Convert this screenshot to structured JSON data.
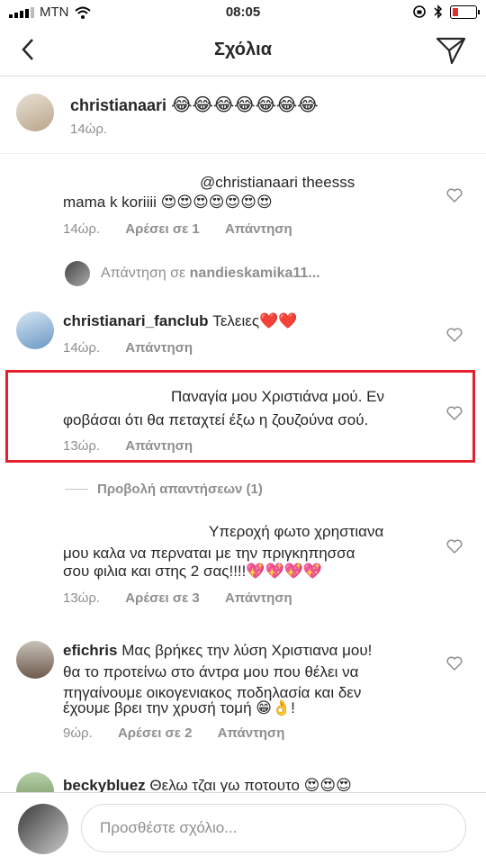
{
  "status_bar": {
    "carrier": "MTN",
    "time": "08:05"
  },
  "header": {
    "title": "Σχόλια"
  },
  "caption": {
    "username": "christianaari",
    "emojis": "😂😂😂😂😂😂😂",
    "time": "14ώρ."
  },
  "comments": [
    {
      "line1": "@christianaari theesss",
      "line2": "mama k koriiii 😍😍😍😍😍😍😍",
      "time": "14ώρ.",
      "likes": "Αρέσει σε 1",
      "reply": "Απάντηση"
    },
    {
      "reply_banner_prefix": "Απάντηση σε",
      "reply_banner_user": "nandieskamika11..."
    },
    {
      "username": "christianari_fanclub",
      "text": "Τελειες❤️❤️",
      "time": "14ώρ.",
      "reply": "Απάντηση"
    },
    {
      "line1": "Παναγία μου Χριστιάνα μού.  Εν",
      "line2": "φοβάσαι ότι θα πεταχτεί έξω η ζουζούνα σού.",
      "time": "13ώρ.",
      "reply": "Απάντηση"
    },
    {
      "view_replies": "Προβολή απαντήσεων (1)"
    },
    {
      "line1": "Υπεροχή  φωτο χρηστιανα",
      "line2": "μου  καλα να περναται  με την πριγκηπησσα",
      "line3": "σου φιλια και στης 2 σας!!!!💖💖💖💖",
      "time": "13ώρ.",
      "likes": "Αρέσει σε 3",
      "reply": "Απάντηση"
    },
    {
      "username": "efichris",
      "line1": "Μας βρήκες την λύση Χριστιανα μου!",
      "line2": "θα το προτείνω στο άντρα μου που θέλει να",
      "line3": "πηγαίνουμε οικογενιακος ποδηλασία και δεν",
      "line4": "έχουμε βρει την χρυσή τομή 😁👌!",
      "time": "9ώρ.",
      "likes": "Αρέσει σε 2",
      "reply": "Απάντηση"
    },
    {
      "username": "beckybluez",
      "text": "Θελω τζαι γω ποτουτο 😍😍😍"
    }
  ],
  "composer": {
    "placeholder": "Προσθέστε σχόλιο..."
  },
  "colors": {
    "highlight": "#e31e2d",
    "heart_red": "#e0302b"
  }
}
